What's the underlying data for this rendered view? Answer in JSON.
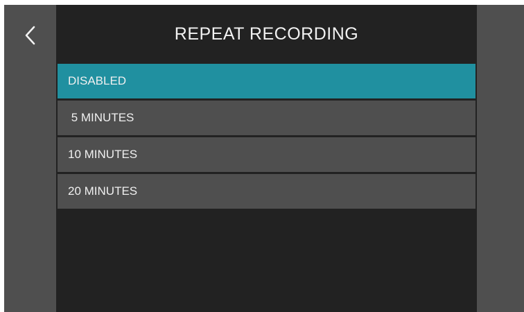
{
  "header": {
    "title": "REPEAT RECORDING",
    "back_icon": "chevron-left-icon"
  },
  "options": [
    {
      "label": "DISABLED",
      "selected": true
    },
    {
      "label": " 5 MINUTES",
      "selected": false
    },
    {
      "label": "10 MINUTES",
      "selected": false
    },
    {
      "label": "20 MINUTES",
      "selected": false
    }
  ],
  "colors": {
    "selected": "#2090a0",
    "option_bg": "#4f4f4f",
    "panel_bg": "#222222",
    "rail_bg": "#4f4f4f"
  }
}
